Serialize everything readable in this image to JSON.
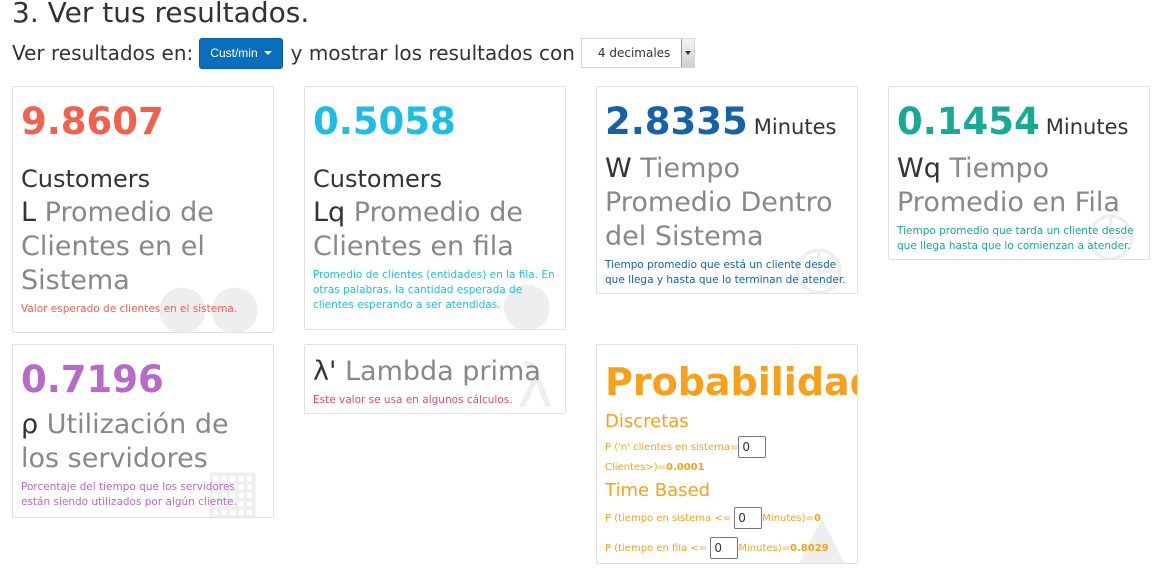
{
  "section": {
    "title": "3. Ver tus resultados."
  },
  "options": {
    "view_label": "Ver resultados en:",
    "unit_button": "Cust/min",
    "show_label": "y mostrar los resultados con",
    "decimals_value": "4 decimales"
  },
  "cards": {
    "L": {
      "value": "9.8607",
      "unit": "",
      "subunit": "Customers",
      "symbol": "L",
      "title": "Promedio de Clientes en el Sistema",
      "description": "Valor esperado de clientes en el sistema.",
      "color": "#f0624d"
    },
    "Lq": {
      "value": "0.5058",
      "unit": "",
      "subunit": "Customers",
      "symbol": "Lq",
      "title": "Promedio de Clientes en fila",
      "description": "Promedio de clientes (entidades) en la fila. En otras palabras, la cantidad esperada de clientes esperando a ser atendidas.",
      "color": "#1dbde6"
    },
    "W": {
      "value": "2.8335",
      "unit": "Minutes",
      "symbol": "W",
      "title": "Tiempo Promedio Dentro del Sistema",
      "description": "Tiempo promedio que está un cliente desde que llega y hasta que lo terminan de atender.",
      "color": "#1562a8"
    },
    "Wq": {
      "value": "0.1454",
      "unit": "Minutes",
      "symbol": "Wq",
      "title": "Tiempo Promedio en Fila",
      "description": "Tiempo promedio que tarda un cliente desde que llega hasta que lo comienzan a atender.",
      "color": "#16a993"
    },
    "rho": {
      "value": "0.7196",
      "symbol": "ρ",
      "title": "Utilización de los servidores",
      "description": "Porcentaje del tiempo que los servidores están siendo utilizados por algún cliente.",
      "color": "#b86ac9"
    },
    "lambda": {
      "symbol": "λ'",
      "title": "Lambda prima",
      "description": "Este valor se usa en algunos cálculos.",
      "color": "#e84a6e"
    }
  },
  "probability": {
    "title": "Probabilidades",
    "discrete_label": "Discretas",
    "discrete_prefix": "P ('n' clientes en sistema=",
    "discrete_input": "0",
    "discrete_suffix": "Clientes>)=",
    "discrete_result": "0.0001",
    "time_label": "Time Based",
    "time_system_prefix": "P (tiempo en sistema <=",
    "time_system_input": "0",
    "time_system_suffix": "Minutes)=",
    "time_system_result": "0",
    "time_queue_prefix": "P (tiempo en fila <=",
    "time_queue_input": "0",
    "time_queue_suffix": "Minutes)=",
    "time_queue_result": "0.8029",
    "color": "#f9a01b"
  }
}
